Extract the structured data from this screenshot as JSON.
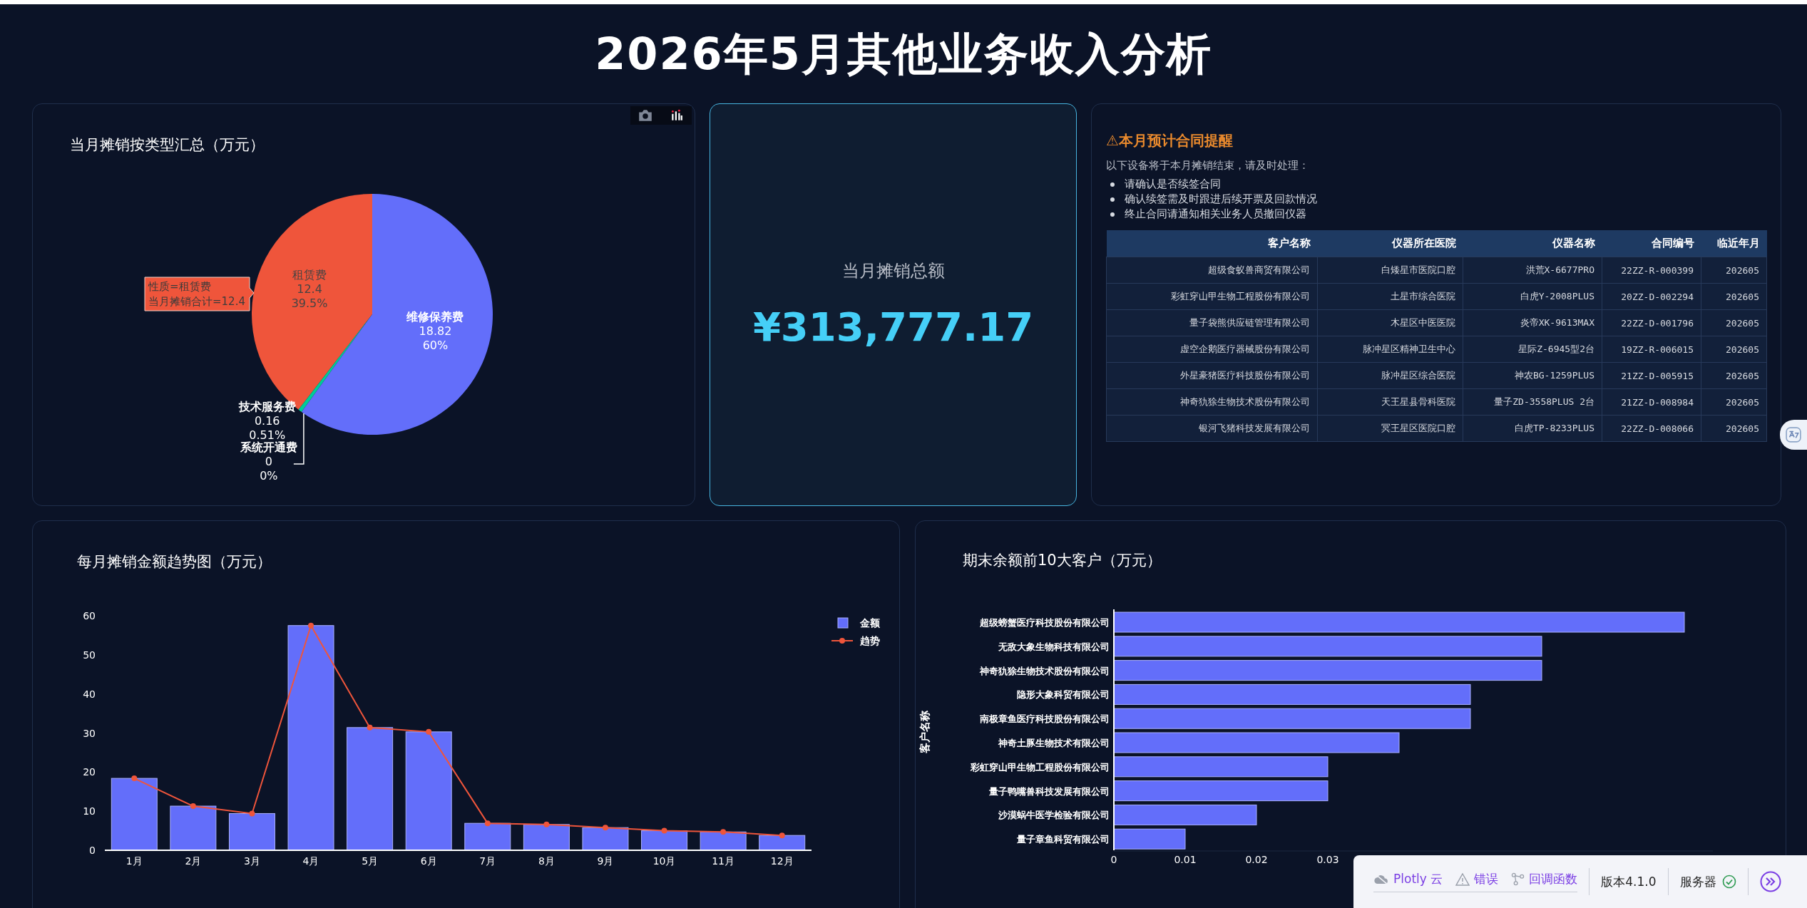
{
  "title": "2026年5月其他业务收入分析",
  "pie_panel": {
    "title": "当月摊销按类型汇总（万元）",
    "slices": [
      {
        "value": "12.4",
        "percent": "39.5%",
        "color": "#ef553b"
      },
      {
        "value": "0.16",
        "percent": "0.51%",
        "color": "#00cc96"
      },
      {
        "value": "0",
        "percent": "0%"
      },
      {
        "value": "18.82",
        "percent": "60%",
        "color": "#636efa"
      }
    ],
    "chart_data": {
      "type": "pie",
      "categories": [
        "租赁费",
        "技术服务费",
        "系统开通费",
        "维修保养费"
      ],
      "values": [
        12.4,
        0.16,
        0,
        18.82
      ],
      "data_labels": true
    },
    "hover_label": [
      "性质=租赁费",
      "当月摊销合计=12.4"
    ]
  },
  "kpi": {
    "label": "当月摊销总额",
    "value": "¥313,777.17"
  },
  "reminder": {
    "title": "⚠本月预计合同提醒",
    "intro": "以下设备将于本月摊销结束，请及时处理：",
    "bullets": [
      "请确认是否续签合同",
      "确认续签需及时跟进后续开票及回款情况",
      "终止合同请通知相关业务人员撤回仪器"
    ],
    "table": {
      "columns": [
        "客户名称",
        "仪器所在医院",
        "仪器名称",
        "合同编号",
        "临近年月"
      ],
      "rows": [
        [
          "超级食蚁兽商贸有限公司",
          "白矮星市医院口腔",
          "洪荒X-6677PRO",
          "22ZZ-R-000399",
          "202605"
        ],
        [
          "彩虹穿山甲生物工程股份有限公司",
          "土星市综合医院",
          "白虎Y-2008PLUS",
          "20ZZ-D-002294",
          "202605"
        ],
        [
          "量子袋熊供应链管理有限公司",
          "木星区中医医院",
          "炎帝XK-9613MAX",
          "22ZZ-D-001796",
          "202605"
        ],
        [
          "虚空企鹅医疗器械股份有限公司",
          "脉冲星区精神卫生中心",
          "星际Z-6945型2台",
          "19ZZ-R-006015",
          "202605"
        ],
        [
          "外星豪猪医疗科技股份有限公司",
          "脉冲星区综合医院",
          "神农BG-1259PLUS",
          "21ZZ-D-005915",
          "202605"
        ],
        [
          "神奇犰狳生物技术股份有限公司",
          "天王星县骨科医院",
          "量子ZD-3558PLUS 2台",
          "21ZZ-D-008984",
          "202605"
        ],
        [
          "银河飞猪科技发展有限公司",
          "冥王星区医院口腔",
          "白虎TP-8233PLUS",
          "22ZZ-D-008066",
          "202605"
        ]
      ]
    }
  },
  "trend_panel": {
    "title": "每月摊销金额趋势图（万元）",
    "chart_data": {
      "type": "bar",
      "categories": [
        "1月",
        "2月",
        "3月",
        "4月",
        "5月",
        "6月",
        "7月",
        "8月",
        "9月",
        "10月",
        "11月",
        "12月"
      ],
      "series": [
        {
          "name": "金额",
          "color": "#636efa",
          "type": "bar",
          "values": [
            18.4,
            11.3,
            9.4,
            57.5,
            31.4,
            30.3,
            6.9,
            6.6,
            5.8,
            5.0,
            4.7,
            3.8
          ]
        },
        {
          "name": "趋势",
          "color": "#ef553b",
          "type": "line",
          "marker": true,
          "values": [
            18.4,
            11.3,
            9.4,
            57.5,
            31.4,
            30.3,
            6.9,
            6.6,
            5.8,
            5.0,
            4.7,
            3.8
          ]
        }
      ],
      "ylim": [
        0,
        60
      ],
      "yticks": [
        0,
        10,
        20,
        30,
        40,
        50,
        60
      ],
      "legend": "right"
    }
  },
  "top_panel": {
    "title": "期末余额前10大客户（万元）",
    "chart_data": {
      "type": "bar",
      "orientation": "h",
      "ylabel": "客户名称",
      "categories": [
        "超级螃蟹医疗科技股份有限公司",
        "无敌大象生物科技有限公司",
        "神奇犰狳生物技术股份有限公司",
        "隐形大象科贸有限公司",
        "南极章鱼医疗科技股份有限公司",
        "神奇土豚生物技术有限公司",
        "彩虹穿山甲生物工程股份有限公司",
        "量子鸭嘴兽科技发展有限公司",
        "沙漠蜗牛医学检验有限公司",
        "量子章鱼科贸有限公司"
      ],
      "values": [
        0.08,
        0.06,
        0.06,
        0.05,
        0.05,
        0.04,
        0.03,
        0.03,
        0.02,
        0.01
      ],
      "xlim": [
        0,
        0.084
      ],
      "xticks": [
        0,
        0.01,
        0.02,
        0.03
      ]
    }
  },
  "devtools": {
    "items": [
      {
        "kind": "cloud",
        "label": "Plotly 云"
      },
      {
        "kind": "error",
        "label": "错误"
      },
      {
        "kind": "callbacks",
        "label": "回调函数"
      }
    ],
    "version": "版本4.1.0",
    "server": "服务器"
  }
}
